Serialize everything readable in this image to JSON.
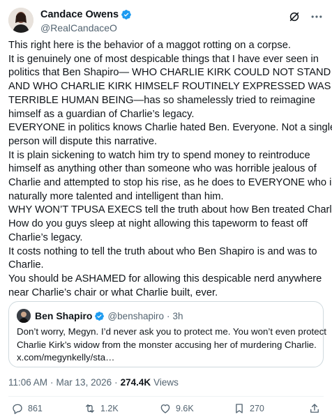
{
  "author": {
    "display_name": "Candace Owens",
    "handle": "@RealCandaceO",
    "verified": true
  },
  "icons": {
    "verified": "verified-badge-icon",
    "grok": "grok-icon",
    "more": "more-horizontal-icon",
    "reply": "reply-icon",
    "repost": "repost-icon",
    "like": "like-icon",
    "bookmark": "bookmark-icon",
    "share": "share-icon"
  },
  "colors": {
    "verified_blue": "#1d9bf0",
    "secondary_text": "#536471",
    "border": "#cfd9de"
  },
  "tweet": {
    "lines": [
      "This right here is the behavior of a maggot rotting on a corpse.",
      "It is genuinely one of most despicable things that I have ever seen in",
      "politics that Ben Shapiro— WHO CHARLIE KIRK COULD NOT STAND",
      "AND WHO CHARLIE KIRK HIMSELF ROUTINELY EXPRESSED WAS A",
      "TERRIBLE HUMAN BEING—has so shamelessly tried to reimagine",
      "himself as a guardian of Charlie’s legacy.",
      "EVERYONE in politics knows Charlie hated Ben. Everyone. Not a single",
      "person will dispute this narrative.",
      "It is plain sickening to watch him try to spend money to reintroduce",
      "himself as anything other than someone who was horrible jealous of",
      "Charlie and attempted to stop his rise, as he does to EVERYONE who is",
      "naturally more talented and intelligent than him.",
      "WHY WON’T TPUSA EXECS tell the truth about how Ben treated Charlie?",
      "How do you guys sleep at night allowing this tapeworm to feast off",
      "Charlie’s legacy.",
      "It costs nothing to tell the truth about who Ben Shapiro is and was to",
      "Charlie.",
      "You should be ASHAMED for allowing this despicable nerd anywhere",
      "near Charlie’s chair or what Charlie built, ever."
    ]
  },
  "quote": {
    "display_name": "Ben Shapiro",
    "handle": "@benshapiro",
    "separator": "·",
    "time": "3h",
    "lines": [
      "Don’t worry, Megyn. I’d never ask you to protect me. You won’t even protect",
      "Charlie Kirk’s widow from the monster accusing her of murdering Charlie.",
      "x.com/megynkelly/sta…"
    ]
  },
  "meta": {
    "time": "11:06 AM",
    "separator": "·",
    "date": "Mar 13, 2026",
    "separator2": "·",
    "views_count": "274.4K",
    "views_label": "Views"
  },
  "actions": {
    "replies": "861",
    "reposts": "1.2K",
    "likes": "9.6K",
    "bookmarks": "270"
  }
}
